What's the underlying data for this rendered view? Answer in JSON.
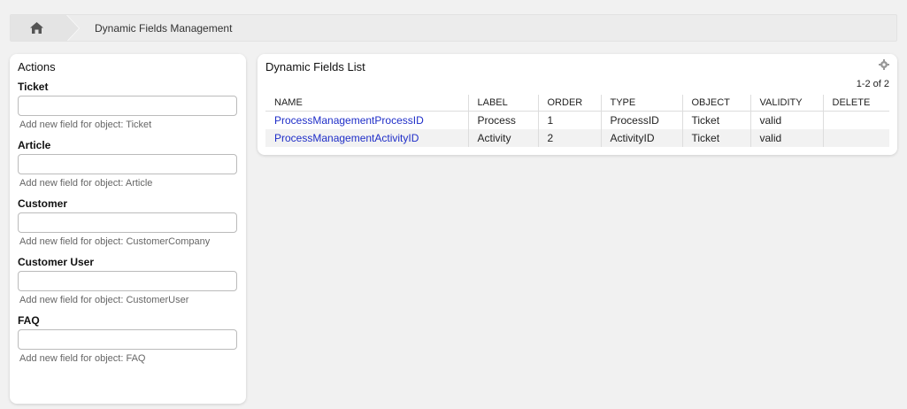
{
  "breadcrumb": {
    "home_icon": "home-icon",
    "title": "Dynamic Fields Management"
  },
  "actions": {
    "title": "Actions",
    "groups": [
      {
        "label": "Ticket",
        "placeholder": "",
        "hint": "Add new field for object: Ticket"
      },
      {
        "label": "Article",
        "placeholder": "",
        "hint": "Add new field for object: Article"
      },
      {
        "label": "Customer",
        "placeholder": "",
        "hint": "Add new field for object: CustomerCompany"
      },
      {
        "label": "Customer User",
        "placeholder": "",
        "hint": "Add new field for object: CustomerUser"
      },
      {
        "label": "FAQ",
        "placeholder": "",
        "hint": "Add new field for object: FAQ"
      }
    ]
  },
  "list": {
    "title": "Dynamic Fields List",
    "settings_icon": "gear-icon",
    "pager": "1-2 of 2",
    "columns": [
      "NAME",
      "LABEL",
      "ORDER",
      "TYPE",
      "OBJECT",
      "VALIDITY",
      "DELETE"
    ],
    "rows": [
      {
        "name": "ProcessManagementProcessID",
        "label": "Process",
        "order": "1",
        "type": "ProcessID",
        "object": "Ticket",
        "validity": "valid",
        "delete": ""
      },
      {
        "name": "ProcessManagementActivityID",
        "label": "Activity",
        "order": "2",
        "type": "ActivityID",
        "object": "Ticket",
        "validity": "valid",
        "delete": ""
      }
    ]
  },
  "colors": {
    "link": "#1f2ec8",
    "background": "#f1f1f1"
  }
}
